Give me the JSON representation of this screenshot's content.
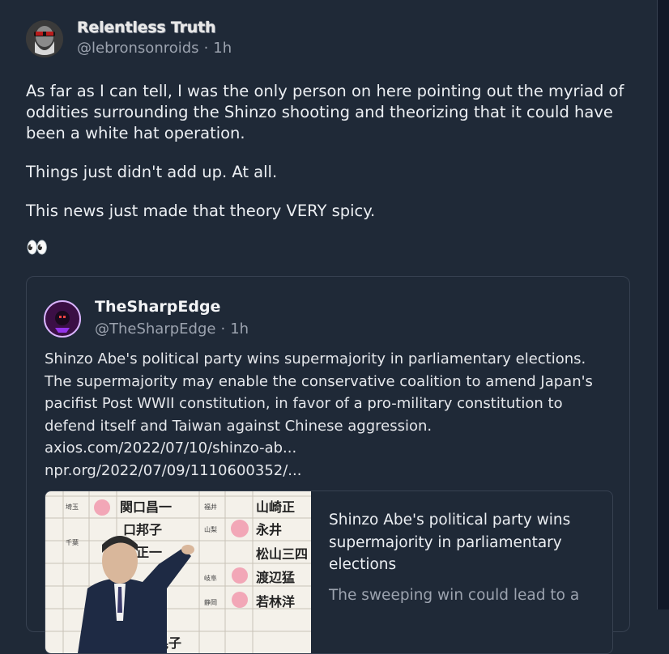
{
  "post": {
    "display_name": "Relentless Truth",
    "handle": "@lebronsonroids",
    "time": "1h",
    "paragraphs": [
      "As far as I can tell, I was the only person on here pointing out the myriad of oddities surrounding the Shinzo shooting and theorizing that it could have been a white hat operation.",
      "Things just didn't add up. At all.",
      "This news just made that theory VERY spicy."
    ],
    "emoji": "👀"
  },
  "quote": {
    "display_name": "TheSharpEdge",
    "handle": "@TheSharpEdge",
    "time": "1h",
    "text": "Shinzo Abe's political party wins supermajority in parliamentary elections. The supermajority may enable the conservative coalition to amend Japan's pacifist Post WWII constitution, in favor of a pro-military constitution to defend itself and Taiwan against Chinese aggression.",
    "links": [
      "axios.com/2022/07/10/shinzo-ab...",
      "npr.org/2022/07/09/1110600352/..."
    ],
    "card": {
      "title": "Shinzo Abe's political party wins supermajority in parliamentary elections",
      "description": "The sweeping win could lead to a",
      "board_names": [
        "関口昌一",
        "口邦子",
        "井正一",
        "晃子",
        "山崎正",
        "永井",
        "松山三四",
        "渡辺猛",
        "若林洋"
      ],
      "board_regions": [
        "埼玉",
        "千葉",
        "福井",
        "山梨",
        "岐阜",
        "静岡"
      ]
    }
  },
  "colors": {
    "background": "#1f2937",
    "border": "#374151",
    "muted": "#9ca3af"
  },
  "icons": {
    "separator": "·"
  }
}
